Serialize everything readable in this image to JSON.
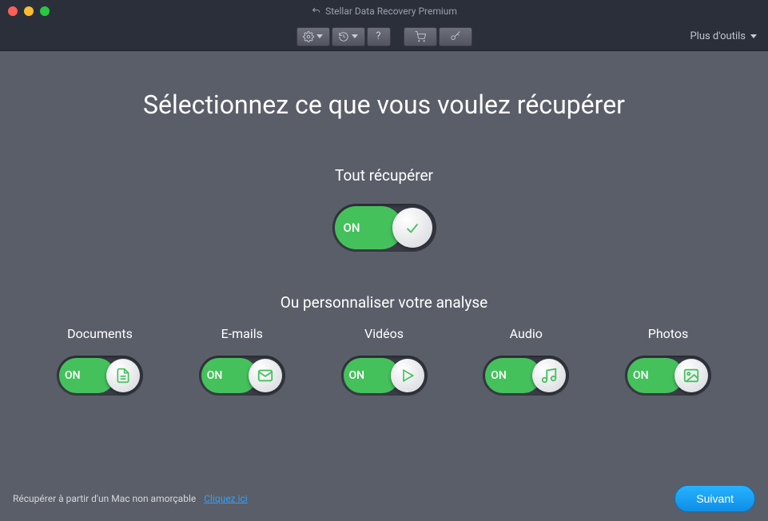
{
  "titlebar": {
    "app_title": "Stellar Data Recovery Premium"
  },
  "toolbar": {
    "more_tools": "Plus d'outils"
  },
  "headline": "Sélectionnez ce que vous voulez récupérer",
  "master": {
    "label": "Tout récupérer",
    "toggle_text": "ON",
    "state": "on"
  },
  "customize_label": "Ou personnaliser votre analyse",
  "toggle_on_text": "ON",
  "categories": [
    {
      "name": "Documents",
      "icon": "document",
      "state": "on"
    },
    {
      "name": "E-mails",
      "icon": "mail",
      "state": "on"
    },
    {
      "name": "Vidéos",
      "icon": "play",
      "state": "on"
    },
    {
      "name": "Audio",
      "icon": "music",
      "state": "on"
    },
    {
      "name": "Photos",
      "icon": "image",
      "state": "on"
    }
  ],
  "footer": {
    "text": "Récupérer à partir d'un Mac non amorçable",
    "link": "Cliquez ici",
    "next": "Suivant"
  }
}
